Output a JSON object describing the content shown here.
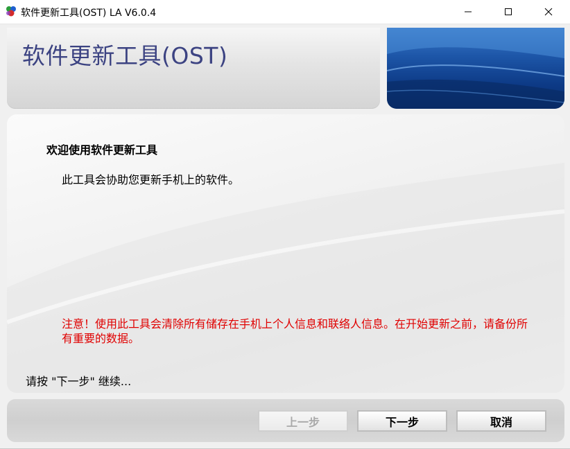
{
  "window": {
    "title": "软件更新工具(OST) LA V6.0.4",
    "controls": [
      "minimize-icon",
      "maximize-icon",
      "close-icon"
    ]
  },
  "header": {
    "title": "软件更新工具(OST)"
  },
  "content": {
    "welcome_title": "欢迎使用软件更新工具",
    "welcome_desc": "此工具会协助您更新手机上的软件。",
    "warning": "注意！使用此工具会清除所有储存在手机上个人信息和联络人信息。在开始更新之前，请备份所有重要的数据。",
    "prompt": "请按 \"下一步\" 继续..."
  },
  "buttons": {
    "back": "上一步",
    "next": "下一步",
    "cancel": "取消"
  },
  "colors": {
    "header_title": "#3c4382",
    "warning": "#e00000",
    "banner_blue": "#1d56a8"
  }
}
